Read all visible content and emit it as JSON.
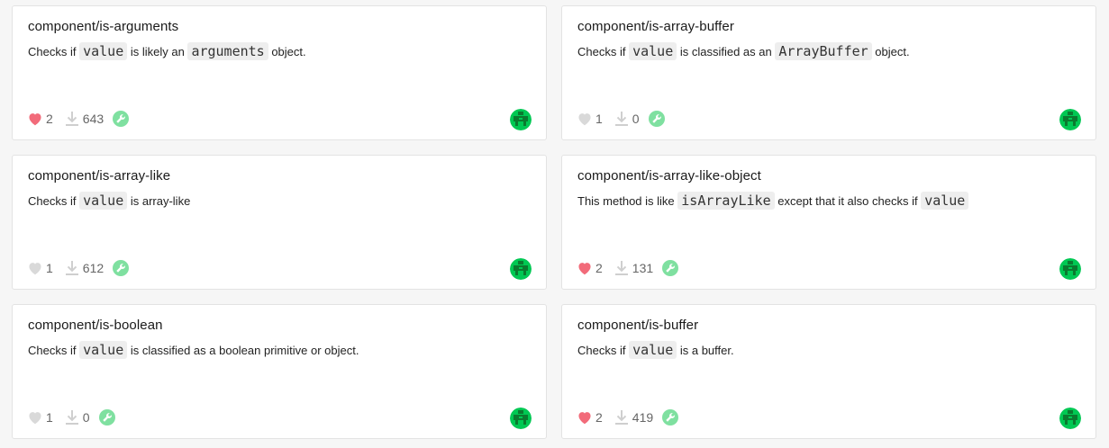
{
  "colors": {
    "heart_liked": "#f26b7a",
    "heart_default": "#d9d9d9",
    "build_badge": "#7fe0a0",
    "avatar_bg": "#00c853"
  },
  "cards": [
    {
      "title": "component/is-arguments",
      "desc": [
        {
          "text": "Checks if "
        },
        {
          "code": "value"
        },
        {
          "text": " is likely an "
        },
        {
          "code": "arguments"
        },
        {
          "text": " object."
        }
      ],
      "likes": "2",
      "liked": true,
      "downloads": "643",
      "icons": {
        "heart": "heart-icon",
        "download": "download-icon",
        "build": "build-status-icon",
        "avatar": "avatar"
      }
    },
    {
      "title": "component/is-array-buffer",
      "desc": [
        {
          "text": "Checks if "
        },
        {
          "code": "value"
        },
        {
          "text": " is classified as an "
        },
        {
          "code": "ArrayBuffer"
        },
        {
          "text": " object."
        }
      ],
      "likes": "1",
      "liked": false,
      "downloads": "0",
      "icons": {
        "heart": "heart-icon",
        "download": "download-icon",
        "build": "build-status-icon",
        "avatar": "avatar"
      }
    },
    {
      "title": "component/is-array-like",
      "desc": [
        {
          "text": "Checks if "
        },
        {
          "code": "value"
        },
        {
          "text": " is array-like"
        }
      ],
      "likes": "1",
      "liked": false,
      "downloads": "612",
      "icons": {
        "heart": "heart-icon",
        "download": "download-icon",
        "build": "build-status-icon",
        "avatar": "avatar"
      }
    },
    {
      "title": "component/is-array-like-object",
      "desc": [
        {
          "text": "This method is like "
        },
        {
          "code": "isArrayLike"
        },
        {
          "text": " except that it also checks if "
        },
        {
          "code": "value"
        }
      ],
      "likes": "2",
      "liked": true,
      "downloads": "131",
      "icons": {
        "heart": "heart-icon",
        "download": "download-icon",
        "build": "build-status-icon",
        "avatar": "avatar"
      }
    },
    {
      "title": "component/is-boolean",
      "desc": [
        {
          "text": "Checks if "
        },
        {
          "code": "value"
        },
        {
          "text": " is classified as a boolean primitive or object."
        }
      ],
      "likes": "1",
      "liked": false,
      "downloads": "0",
      "icons": {
        "heart": "heart-icon",
        "download": "download-icon",
        "build": "build-status-icon",
        "avatar": "avatar"
      }
    },
    {
      "title": "component/is-buffer",
      "desc": [
        {
          "text": "Checks if "
        },
        {
          "code": "value"
        },
        {
          "text": " is a buffer."
        }
      ],
      "likes": "2",
      "liked": true,
      "downloads": "419",
      "icons": {
        "heart": "heart-icon",
        "download": "download-icon",
        "build": "build-status-icon",
        "avatar": "avatar"
      }
    }
  ]
}
